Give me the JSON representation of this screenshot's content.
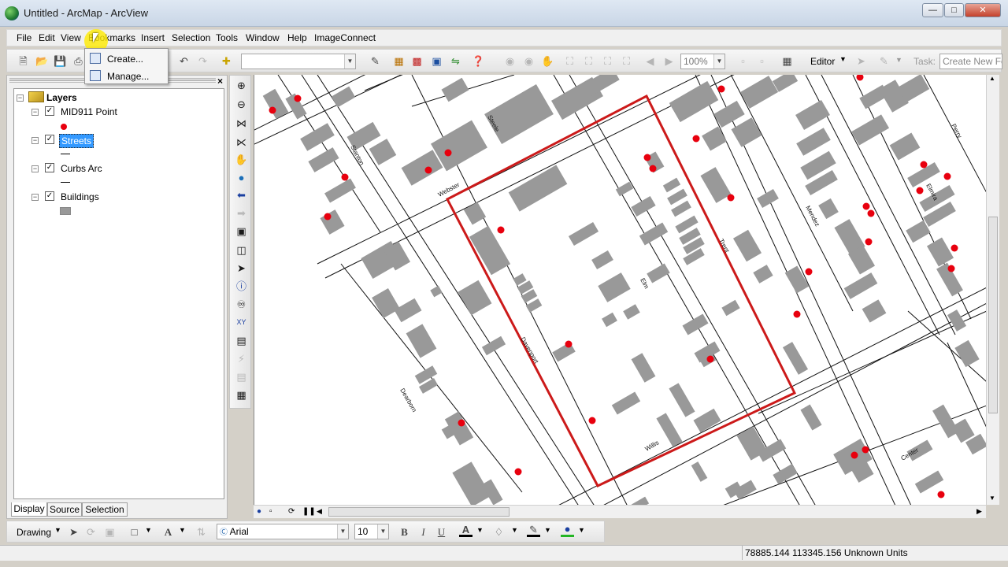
{
  "window": {
    "title": "Untitled - ArcMap - ArcView"
  },
  "menus": [
    "File",
    "Edit",
    "View",
    "Bookmarks",
    "Insert",
    "Selection",
    "Tools",
    "Window",
    "Help",
    "ImageConnect"
  ],
  "bookmarks_menu": {
    "items": [
      "Create...",
      "Manage..."
    ]
  },
  "toolbar": {
    "scale_value": "",
    "zoom_value": "100%",
    "editor_label": "Editor",
    "task_label": "Task:",
    "task_value": "Create New Fe"
  },
  "toc": {
    "root_label": "Layers",
    "layers": [
      {
        "name": "MID911 Point",
        "checked": true,
        "symbol": "point"
      },
      {
        "name": "Streets",
        "checked": true,
        "symbol": "line",
        "selected": true
      },
      {
        "name": "Curbs Arc",
        "checked": true,
        "symbol": "line"
      },
      {
        "name": "Buildings",
        "checked": true,
        "symbol": "polygon"
      }
    ],
    "tabs": [
      "Display",
      "Source",
      "Selection"
    ]
  },
  "map": {
    "street_labels": [
      "Webster",
      "Davenport",
      "Elm",
      "Trent",
      "Willis",
      "Dearborn",
      "Mendez",
      "Elmira",
      "Center",
      "Perry",
      "Steele",
      "Stanton"
    ],
    "colors": {
      "building": "#999999",
      "point": "#e8000e",
      "selection": "#cc1a1a",
      "street": "#111111"
    }
  },
  "drawing_toolbar": {
    "drawing_label": "Drawing",
    "font_value": "Arial",
    "size_value": "10",
    "bold": "B",
    "italic": "I",
    "underline": "U",
    "text_tool": "A"
  },
  "status": {
    "coordinates": "78885.144  113345.156 Unknown Units"
  }
}
